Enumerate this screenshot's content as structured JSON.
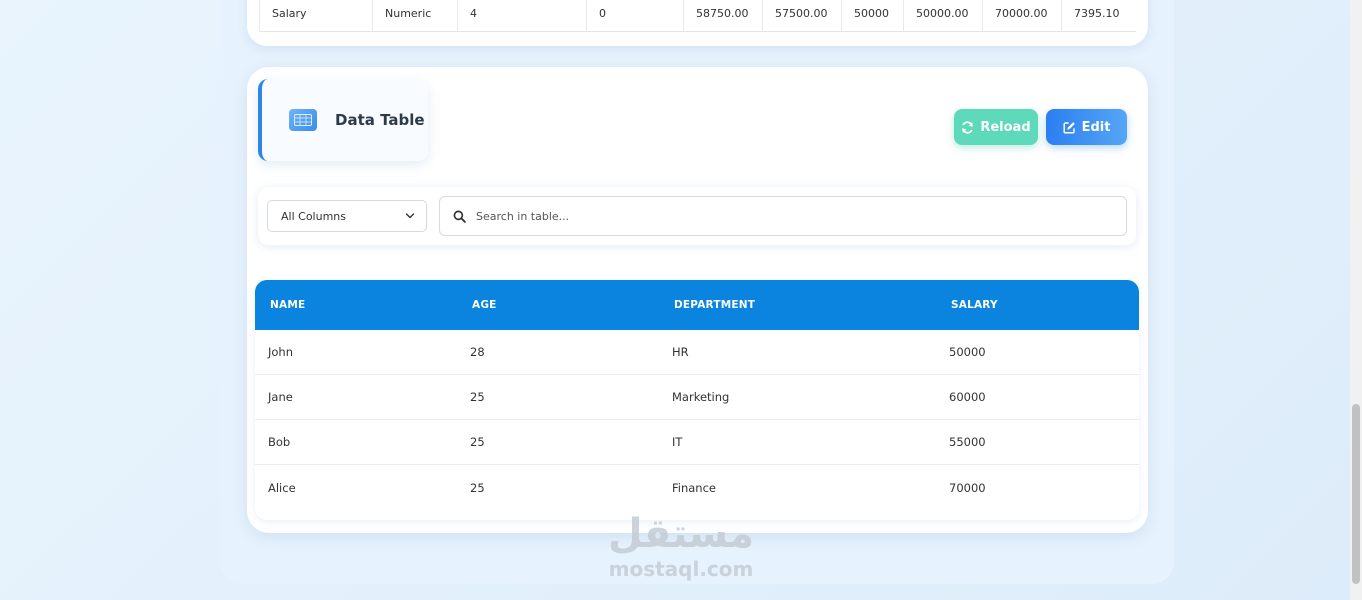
{
  "stats_row": {
    "cells": [
      "Salary",
      "Numeric",
      "4",
      "0",
      "58750.00",
      "57500.00",
      "50000",
      "50000.00",
      "70000.00",
      "7395.10"
    ]
  },
  "data_table": {
    "title": "Data Table",
    "icon": "table-icon",
    "reload_label": "Reload",
    "edit_label": "Edit"
  },
  "filter": {
    "column_select_value": "All Columns",
    "search_placeholder": "Search in table..."
  },
  "table": {
    "headers": [
      "NAME",
      "AGE",
      "DEPARTMENT",
      "SALARY"
    ],
    "rows": [
      [
        "John",
        "28",
        "HR",
        "50000"
      ],
      [
        "Jane",
        "25",
        "Marketing",
        "60000"
      ],
      [
        "Bob",
        "25",
        "IT",
        "55000"
      ],
      [
        "Alice",
        "25",
        "Finance",
        "70000"
      ]
    ]
  },
  "watermark": {
    "arabic": "مستقل",
    "latin": "mostaql.com"
  },
  "colors": {
    "header_blue": "#0b84e0",
    "reload_green": "#5ed9b9",
    "edit_blue": "#2c7ff0"
  }
}
